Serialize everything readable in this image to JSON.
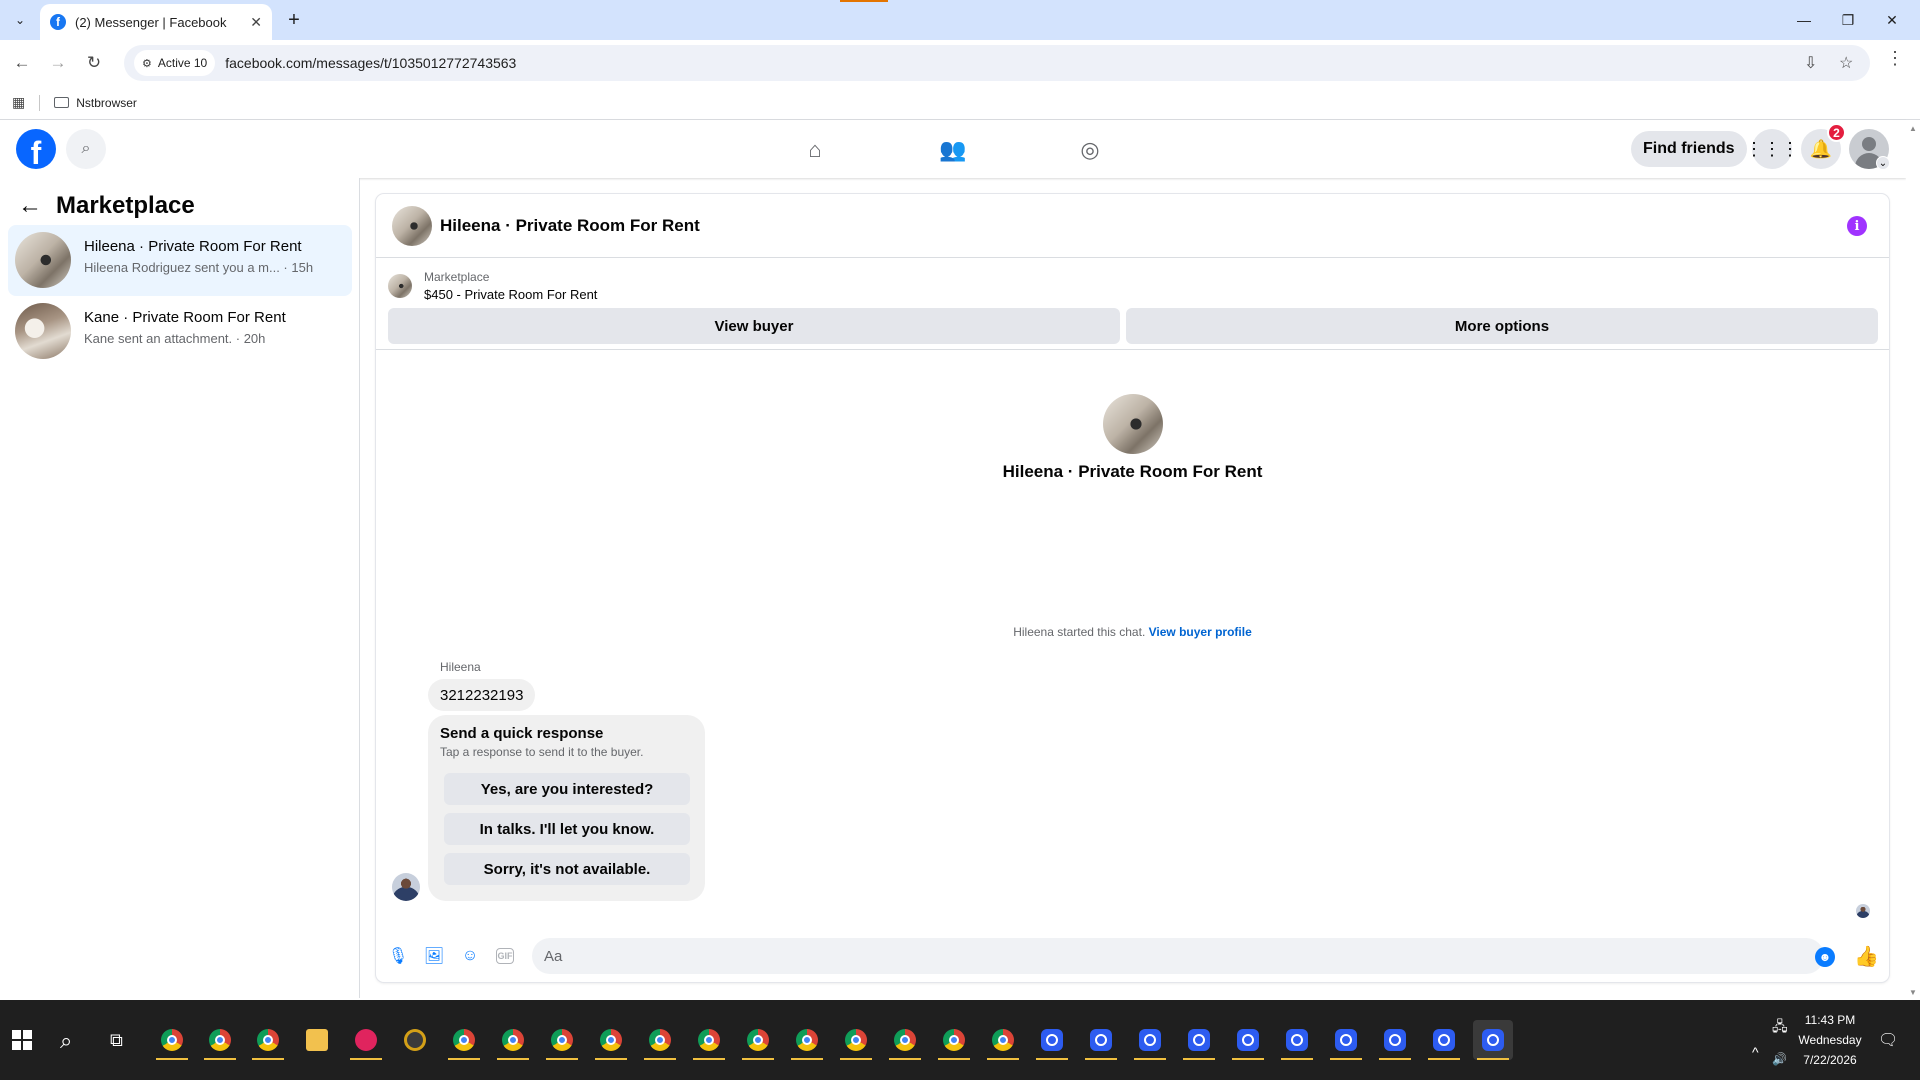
{
  "browser": {
    "tab_title": "(2) Messenger | Facebook",
    "tab_favicon": "f",
    "address_chip": "Active 10",
    "url": "facebook.com/messages/t/1035012772743563",
    "bookmark_folder": "Nstbrowser"
  },
  "fb_header": {
    "logo": "f",
    "find_friends": "Find friends",
    "notification_count": "2",
    "brand_color": "#0866ff"
  },
  "sidebar": {
    "title": "Marketplace",
    "conversations": [
      {
        "name": "Hileena · Private Room For Rent",
        "preview": "Hileena Rodriguez sent you a m... · 15h",
        "active": true
      },
      {
        "name": "Kane · Private Room For Rent",
        "preview": "Kane sent an attachment. · 20h",
        "active": false
      }
    ]
  },
  "chat": {
    "title": "Hileena · Private Room For Rent",
    "listing_label": "Marketplace",
    "listing_price": "$450 - Private Room For Rent",
    "view_buyer": "View buyer",
    "more_options": "More options",
    "intro_title": "Hileena · Private Room For Rent",
    "started_text": "Hileena started this chat.",
    "started_link": "View buyer profile",
    "sender": "Hileena",
    "message": "3212232193",
    "quick_title": "Send a quick response",
    "quick_sub": "Tap a response to send it to the buyer.",
    "quick_replies": [
      "Yes, are you interested?",
      "In talks. I'll let you know.",
      "Sorry, it's not available."
    ],
    "composer_placeholder": "Aa",
    "gif_label": "GIF",
    "accent_color": "#0a7cff"
  },
  "taskbar": {
    "time": "11:43 PM",
    "day": "Wednesday",
    "date": "7/22/2026"
  }
}
